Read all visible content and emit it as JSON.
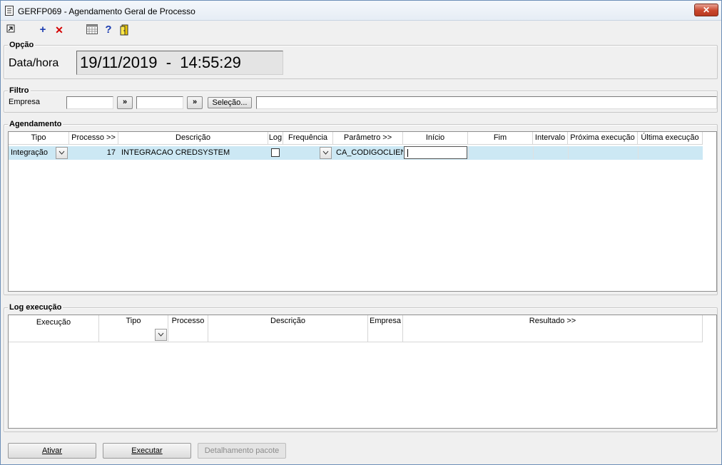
{
  "window": {
    "title": "GERFP069 - Agendamento Geral de Processo",
    "close_label": "✕"
  },
  "toolbar": {
    "icons": [
      "exit-icon",
      "add-icon",
      "delete-icon",
      "calendar-icon",
      "help-icon",
      "door-icon"
    ]
  },
  "opcao": {
    "legend": "Opção",
    "datahora_label": "Data/hora",
    "datahora_value": "19/11/2019  -  14:55:29"
  },
  "filtro": {
    "legend": "Filtro",
    "empresa_label": "Empresa",
    "empresa_from": "",
    "empresa_to": "",
    "lookup_label": "»",
    "selecao_label": "Seleção...",
    "selecao_value": ""
  },
  "agendamento": {
    "legend": "Agendamento",
    "columns": [
      "Tipo",
      "Processo >>",
      "Descrição",
      "Log",
      "Frequência",
      "Parâmetro >>",
      "Início",
      "Fim",
      "Intervalo",
      "Próxima execução",
      "Última execução"
    ],
    "row": {
      "tipo": "Integração",
      "processo": "17",
      "descricao": "INTEGRACAO CREDSYSTEM",
      "frequencia": "",
      "parametro": "CA_CODIGOCLIENT",
      "inicio": "",
      "fim": "",
      "intervalo": "",
      "proxima": "",
      "ultima": ""
    }
  },
  "log": {
    "legend": "Log execução",
    "columns": [
      "Execução",
      "Tipo",
      "Processo",
      "Descrição",
      "Empresa",
      "Resultado >>"
    ]
  },
  "buttons": {
    "ativar": "Ativar",
    "executar": "Executar",
    "detalhamento": "Detalhamento pacote"
  },
  "colors": {
    "selected_row": "#cce8f4",
    "titlebar": "#e6edf5"
  }
}
